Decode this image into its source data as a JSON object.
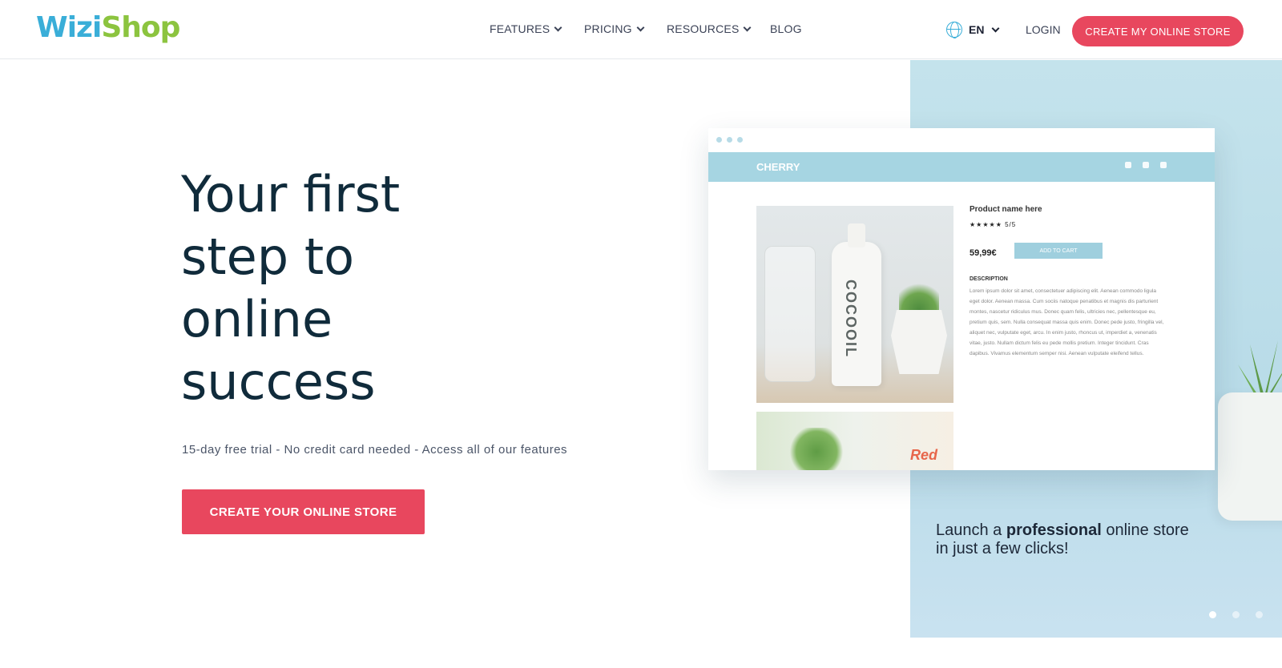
{
  "brand": {
    "logo_part1": "Wizi",
    "logo_part2": "Shop",
    "accent": "#e8475e",
    "logo_blue": "#3aaed8",
    "logo_green": "#8cc43f"
  },
  "nav": {
    "items": [
      {
        "label": "FEATURES",
        "dropdown": true
      },
      {
        "label": "PRICING",
        "dropdown": true
      },
      {
        "label": "RESOURCES",
        "dropdown": true
      },
      {
        "label": "BLOG",
        "dropdown": false
      }
    ],
    "language": "EN",
    "login": "LOGIN",
    "cta": "CREATE MY ONLINE STORE"
  },
  "hero": {
    "title_lines": [
      "Your first",
      "step to",
      "online",
      "success"
    ],
    "subtitle": "15-day free trial - No credit card needed - Access all of our features",
    "cta": "CREATE YOUR ONLINE STORE"
  },
  "slide": {
    "tagline_pre": "Launch a ",
    "tagline_bold": "professional",
    "tagline_post": " online store in just a few clicks!",
    "dots": 3,
    "active_dot": 0
  },
  "mockup": {
    "store_name": "CHERRY",
    "product_name": "Product name here",
    "rating": "★★★★★  5/5",
    "price": "59,99€",
    "add_to_cart": "ADD TO CART",
    "description_heading": "DESCRIPTION",
    "description": "Lorem ipsum dolor sit amet, consectetuer adipiscing elit. Aenean commodo ligula eget dolor. Aenean massa. Cum sociis natoque penatibus et magnis dis parturient montes, nascetur ridiculus mus. Donec quam felis, ultricies nec, pellentesque eu, pretium quis, sem. Nulla consequat massa quis enim. Donec pede justo, fringilla vel, aliquet nec, vulputate eget, arcu. In enim justo, rhoncus ut, imperdiet a, venenatis vitae, justo. Nullam dictum felis eu pede mollis pretium. Integer tincidunt. Cras dapibus. Vivamus elementum semper nisi. Aenean vulputate eleifend tellus.",
    "bottle_label": "COCOOIL",
    "second_bottle_label": "Red"
  }
}
